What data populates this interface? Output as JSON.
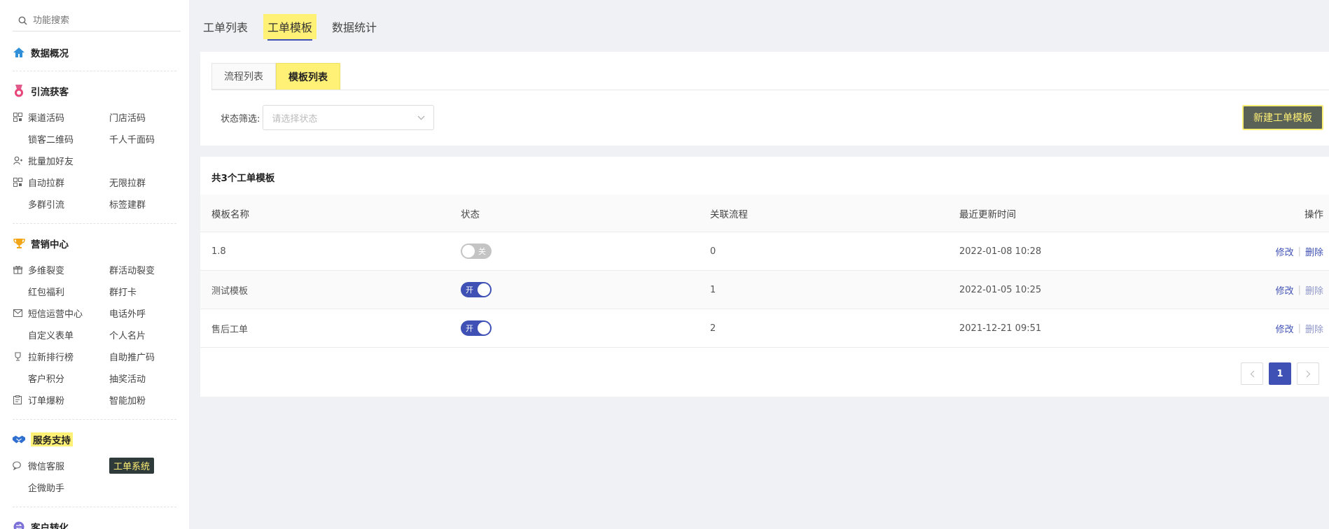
{
  "search": {
    "placeholder": "功能搜索"
  },
  "sidebar": {
    "overview": "数据概况",
    "sec_traffic": {
      "title": "引流获客",
      "items": [
        "渠道活码",
        "门店活码",
        "锁客二维码",
        "千人千面码",
        "批量加好友",
        "自动拉群",
        "无限拉群",
        "多群引流",
        "标签建群"
      ]
    },
    "sec_marketing": {
      "title": "营销中心",
      "items": [
        "多维裂变",
        "群活动裂变",
        "红包福利",
        "群打卡",
        "短信运营中心",
        "电话外呼",
        "自定义表单",
        "个人名片",
        "拉新排行榜",
        "自助推广码",
        "客户积分",
        "抽奖活动",
        "订单爆粉",
        "智能加粉"
      ]
    },
    "sec_service": {
      "title": "服务支持",
      "items": [
        "微信客服",
        "工单系统",
        "企微助手"
      ]
    },
    "sec_convert": {
      "title": "客户转化"
    }
  },
  "top_tabs": [
    "工单列表",
    "工单模板",
    "数据统计"
  ],
  "sub_tabs": [
    "流程列表",
    "模板列表"
  ],
  "filter": {
    "label": "状态筛选:",
    "placeholder": "请选择状态"
  },
  "new_button": "新建工单模板",
  "table": {
    "count_text": "共3个工单模板",
    "headers": [
      "模板名称",
      "状态",
      "关联流程",
      "最近更新时间",
      "操作"
    ],
    "rows": [
      {
        "name": "1.8",
        "status": "关",
        "flows": "0",
        "updated": "2022-01-08 10:28"
      },
      {
        "name": "测试模板",
        "status": "开",
        "flows": "1",
        "updated": "2022-01-05 10:25"
      },
      {
        "name": "售后工单",
        "status": "开",
        "flows": "2",
        "updated": "2021-12-21 09:51"
      }
    ],
    "edit_label": "修改",
    "delete_label": "删除"
  },
  "pagination": {
    "current": "1"
  },
  "colors": {
    "accent": "#3f51b5",
    "highlight": "#fff176"
  }
}
